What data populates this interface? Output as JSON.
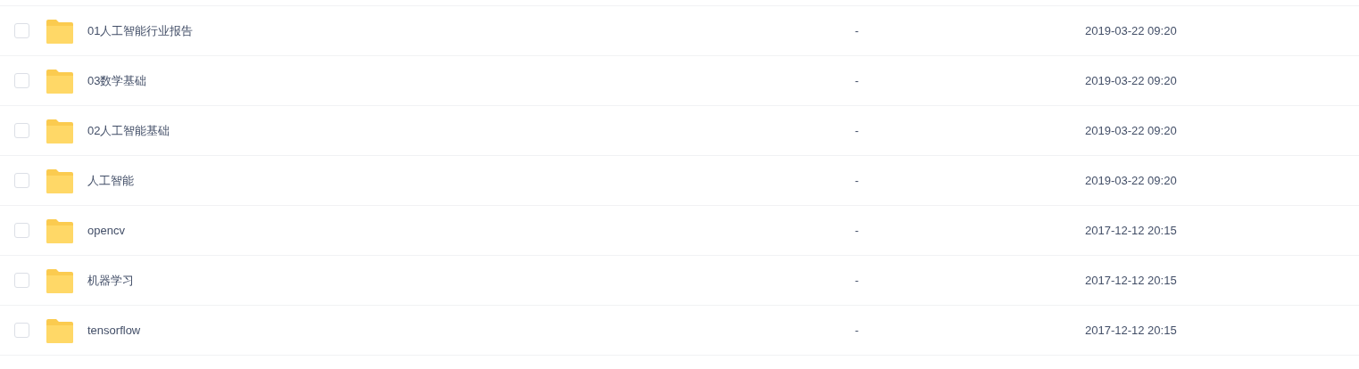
{
  "files": [
    {
      "name": "01人工智能行业报告",
      "size": "-",
      "modified": "2019-03-22 09:20",
      "checked": false
    },
    {
      "name": "03数学基础",
      "size": "-",
      "modified": "2019-03-22 09:20",
      "checked": false
    },
    {
      "name": "02人工智能基础",
      "size": "-",
      "modified": "2019-03-22 09:20",
      "checked": false
    },
    {
      "name": "人工智能",
      "size": "-",
      "modified": "2019-03-22 09:20",
      "checked": false
    },
    {
      "name": "opencv",
      "size": "-",
      "modified": "2017-12-12 20:15",
      "checked": false
    },
    {
      "name": "机器学习",
      "size": "-",
      "modified": "2017-12-12 20:15",
      "checked": false
    },
    {
      "name": "tensorflow",
      "size": "-",
      "modified": "2017-12-12 20:15",
      "checked": false
    }
  ]
}
